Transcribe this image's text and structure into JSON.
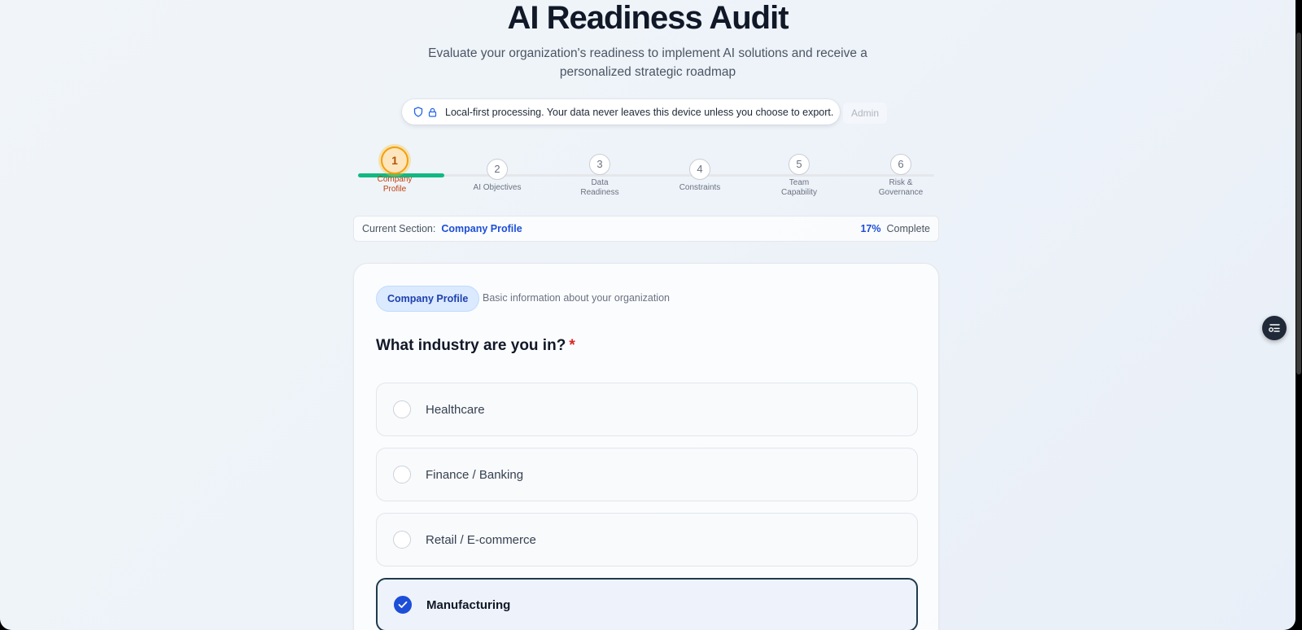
{
  "page": {
    "title": "AI Readiness Audit",
    "subtitle": "Evaluate your organization's readiness to implement AI solutions and receive a personalized strategic roadmap"
  },
  "privacy": {
    "text": "Local-first processing. Your data never leaves this device unless you choose to export.",
    "icons": [
      "shield-icon",
      "lock-icon"
    ]
  },
  "admin": {
    "label": "Admin"
  },
  "stepper": {
    "progress_fraction": 0.15,
    "steps": [
      {
        "number": "1",
        "label": "Company Profile",
        "state": "active"
      },
      {
        "number": "2",
        "label": "AI Objectives",
        "state": "pending"
      },
      {
        "number": "3",
        "label": "Data Readiness",
        "state": "pending"
      },
      {
        "number": "4",
        "label": "Constraints",
        "state": "pending"
      },
      {
        "number": "5",
        "label": "Team Capability",
        "state": "pending"
      },
      {
        "number": "6",
        "label": "Risk & Governance",
        "state": "pending"
      }
    ]
  },
  "section_bar": {
    "prefix": "Current Section:",
    "name": "Company Profile",
    "percent": "17%",
    "complete_label": "Complete"
  },
  "card": {
    "badge": "Company Profile",
    "description": "Basic information about your organization",
    "question": "What industry are you in?",
    "required_mark": "*",
    "options": [
      {
        "label": "Healthcare",
        "selected": false
      },
      {
        "label": "Finance / Banking",
        "selected": false
      },
      {
        "label": "Retail / E-commerce",
        "selected": false
      },
      {
        "label": "Manufacturing",
        "selected": true
      }
    ]
  },
  "colors": {
    "accent_blue": "#1d4ed8",
    "active_step": "#f59e0b",
    "progress_green": "#10b981",
    "required_red": "#dc2626"
  }
}
